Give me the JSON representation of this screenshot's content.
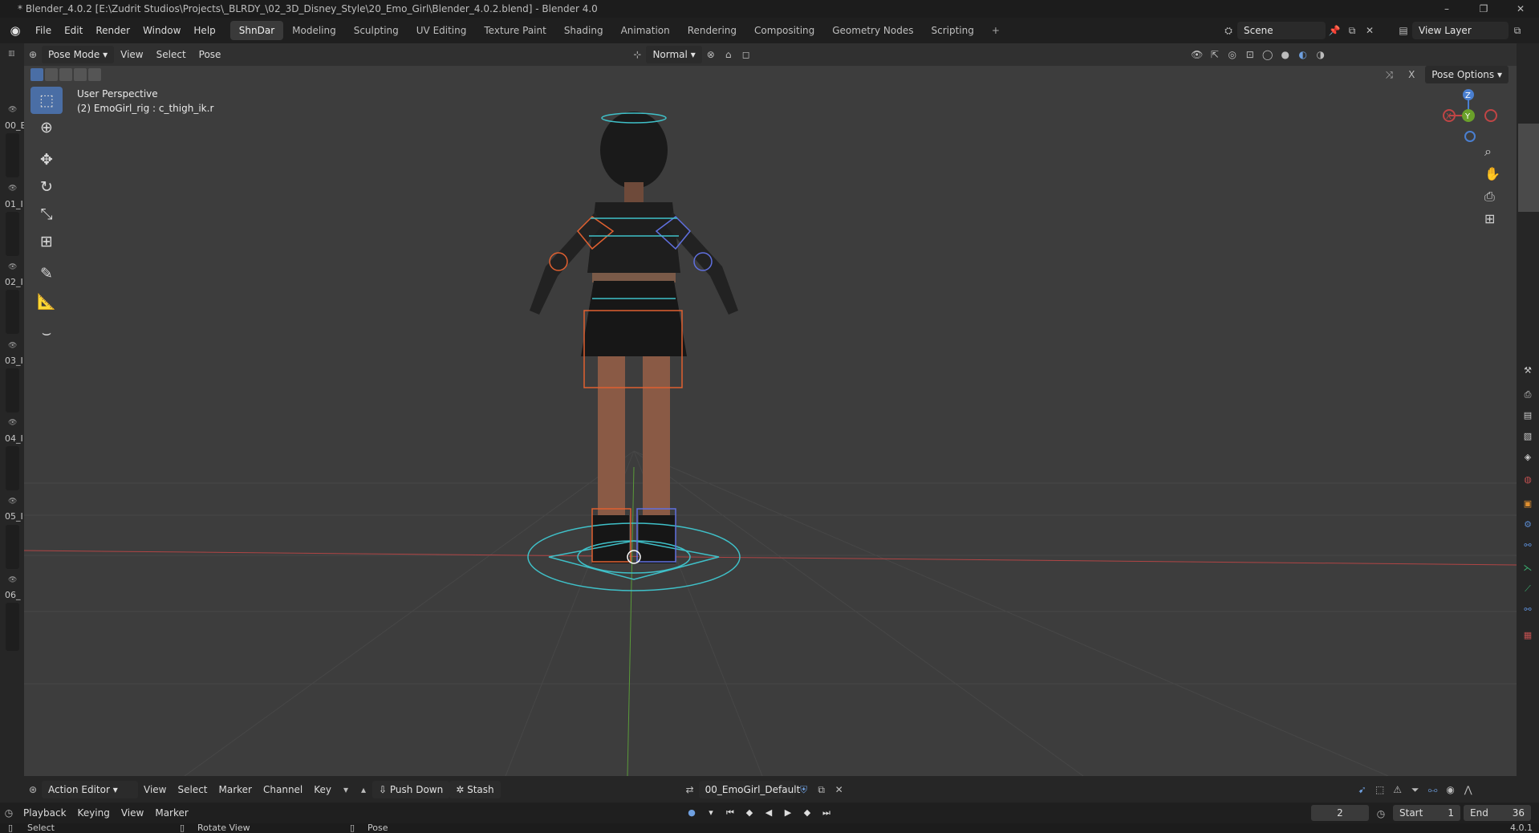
{
  "window": {
    "title": "* Blender_4.0.2 [E:\\Zudrit Studios\\Projects\\_BLRDY_\\02_3D_Disney_Style\\20_Emo_Girl\\Blender_4.0.2.blend] - Blender 4.0"
  },
  "menu": [
    "File",
    "Edit",
    "Render",
    "Window",
    "Help"
  ],
  "workspaces": [
    "ShnDar",
    "Modeling",
    "Sculpting",
    "UV Editing",
    "Texture Paint",
    "Shading",
    "Animation",
    "Rendering",
    "Compositing",
    "Geometry Nodes",
    "Scripting"
  ],
  "workspace_add": "+",
  "scene": {
    "name": "Scene"
  },
  "view_layer": {
    "name": "View Layer"
  },
  "viewport_header": {
    "mode": "Pose Mode",
    "menus": [
      "View",
      "Select",
      "Pose"
    ],
    "orientation": "Normal"
  },
  "viewport": {
    "perspective": "User Perspective",
    "active": "(2) EmoGirl_rig : c_thigh_ik.r",
    "pose_options": "Pose Options",
    "close": "X"
  },
  "gizmo": {
    "z": "Z",
    "y": "Y",
    "x": "X"
  },
  "collections": [
    "00_E",
    "01_I",
    "02_I",
    "03_I",
    "04_I",
    "05_I",
    "06_"
  ],
  "dopesheet": {
    "editor": "Action Editor",
    "menus": [
      "View",
      "Select",
      "Marker",
      "Channel",
      "Key"
    ],
    "push_down": "Push Down",
    "stash": "Stash",
    "action": "00_EmoGirl_Default"
  },
  "timeline": {
    "menus": [
      "Playback",
      "Keying",
      "View",
      "Marker"
    ],
    "current_frame": "2",
    "start_label": "Start",
    "start": "1",
    "end_label": "End",
    "end": "36"
  },
  "status": {
    "select": "Select",
    "rotate": "Rotate View",
    "pose": "Pose",
    "version": "4.0.1"
  }
}
